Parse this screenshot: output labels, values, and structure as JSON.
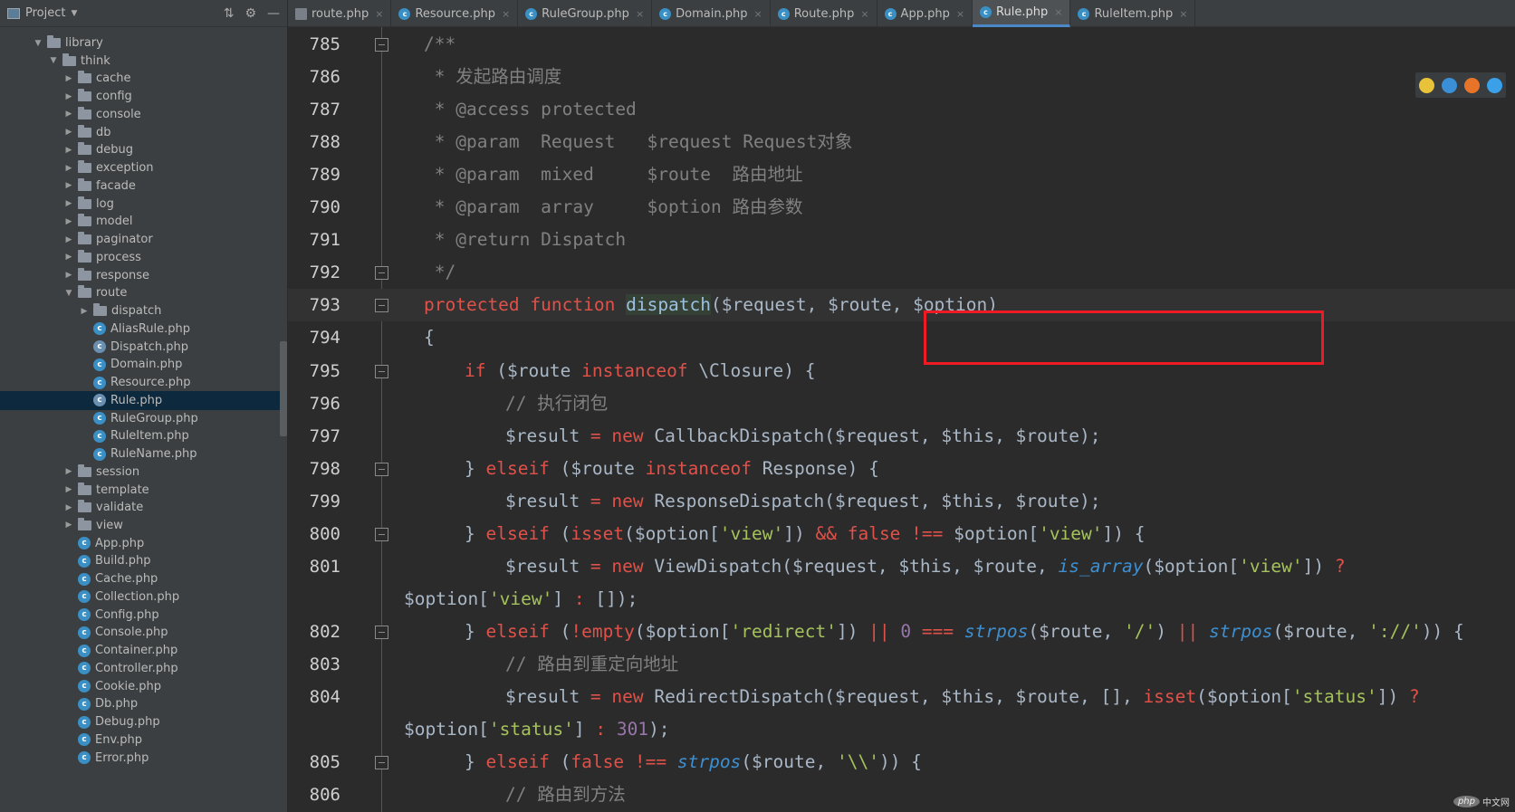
{
  "project_panel": {
    "title": "Project",
    "tree": [
      {
        "label": "library",
        "type": "folder",
        "depth": 0,
        "state": "expanded"
      },
      {
        "label": "think",
        "type": "folder",
        "depth": 1,
        "state": "expanded"
      },
      {
        "label": "cache",
        "type": "folder",
        "depth": 2,
        "state": "collapsed"
      },
      {
        "label": "config",
        "type": "folder",
        "depth": 2,
        "state": "collapsed"
      },
      {
        "label": "console",
        "type": "folder",
        "depth": 2,
        "state": "collapsed"
      },
      {
        "label": "db",
        "type": "folder",
        "depth": 2,
        "state": "collapsed"
      },
      {
        "label": "debug",
        "type": "folder",
        "depth": 2,
        "state": "collapsed"
      },
      {
        "label": "exception",
        "type": "folder",
        "depth": 2,
        "state": "collapsed"
      },
      {
        "label": "facade",
        "type": "folder",
        "depth": 2,
        "state": "collapsed"
      },
      {
        "label": "log",
        "type": "folder",
        "depth": 2,
        "state": "collapsed"
      },
      {
        "label": "model",
        "type": "folder",
        "depth": 2,
        "state": "collapsed"
      },
      {
        "label": "paginator",
        "type": "folder",
        "depth": 2,
        "state": "collapsed"
      },
      {
        "label": "process",
        "type": "folder",
        "depth": 2,
        "state": "collapsed"
      },
      {
        "label": "response",
        "type": "folder",
        "depth": 2,
        "state": "collapsed"
      },
      {
        "label": "route",
        "type": "folder",
        "depth": 2,
        "state": "expanded"
      },
      {
        "label": "dispatch",
        "type": "folder",
        "depth": 3,
        "state": "collapsed"
      },
      {
        "label": "AliasRule.php",
        "type": "class",
        "depth": 3
      },
      {
        "label": "Dispatch.php",
        "type": "abstract",
        "depth": 3
      },
      {
        "label": "Domain.php",
        "type": "class",
        "depth": 3
      },
      {
        "label": "Resource.php",
        "type": "class",
        "depth": 3
      },
      {
        "label": "Rule.php",
        "type": "abstract",
        "depth": 3,
        "selected": true
      },
      {
        "label": "RuleGroup.php",
        "type": "class",
        "depth": 3
      },
      {
        "label": "RuleItem.php",
        "type": "class",
        "depth": 3
      },
      {
        "label": "RuleName.php",
        "type": "class",
        "depth": 3
      },
      {
        "label": "session",
        "type": "folder",
        "depth": 2,
        "state": "collapsed"
      },
      {
        "label": "template",
        "type": "folder",
        "depth": 2,
        "state": "collapsed"
      },
      {
        "label": "validate",
        "type": "folder",
        "depth": 2,
        "state": "collapsed"
      },
      {
        "label": "view",
        "type": "folder",
        "depth": 2,
        "state": "collapsed"
      },
      {
        "label": "App.php",
        "type": "class",
        "depth": 2
      },
      {
        "label": "Build.php",
        "type": "class",
        "depth": 2
      },
      {
        "label": "Cache.php",
        "type": "class",
        "depth": 2
      },
      {
        "label": "Collection.php",
        "type": "class",
        "depth": 2
      },
      {
        "label": "Config.php",
        "type": "class",
        "depth": 2
      },
      {
        "label": "Console.php",
        "type": "class",
        "depth": 2
      },
      {
        "label": "Container.php",
        "type": "class",
        "depth": 2
      },
      {
        "label": "Controller.php",
        "type": "class",
        "depth": 2
      },
      {
        "label": "Cookie.php",
        "type": "class",
        "depth": 2
      },
      {
        "label": "Db.php",
        "type": "class",
        "depth": 2
      },
      {
        "label": "Debug.php",
        "type": "class",
        "depth": 2
      },
      {
        "label": "Env.php",
        "type": "class",
        "depth": 2
      },
      {
        "label": "Error.php",
        "type": "class",
        "depth": 2
      }
    ]
  },
  "tabs": [
    {
      "label": "route.php",
      "icon": "php-file-icon",
      "active": false
    },
    {
      "label": "Resource.php",
      "icon": "class-icon",
      "active": false
    },
    {
      "label": "RuleGroup.php",
      "icon": "class-icon",
      "active": false
    },
    {
      "label": "Domain.php",
      "icon": "class-icon",
      "active": false
    },
    {
      "label": "Route.php",
      "icon": "class-icon",
      "active": false
    },
    {
      "label": "App.php",
      "icon": "class-icon",
      "active": false
    },
    {
      "label": "Rule.php",
      "icon": "abstract-class-icon",
      "active": true
    },
    {
      "label": "RuleItem.php",
      "icon": "class-icon",
      "active": false
    }
  ],
  "editor": {
    "current_line": "793",
    "lines": [
      {
        "num": "785",
        "fold": true,
        "html": "<span class='c'>/**</span>",
        "indent": 1
      },
      {
        "num": "786",
        "html": "<span class='c'> * 发起路由调度</span>",
        "indent": 1
      },
      {
        "num": "787",
        "html": "<span class='c'> * @access protected</span>",
        "indent": 1
      },
      {
        "num": "788",
        "html": "<span class='c'> * @param  Request   $request Request对象</span>",
        "indent": 1
      },
      {
        "num": "789",
        "html": "<span class='c'> * @param  mixed     $route  路由地址</span>",
        "indent": 1
      },
      {
        "num": "790",
        "html": "<span class='c'> * @param  array     $option 路由参数</span>",
        "indent": 1
      },
      {
        "num": "791",
        "html": "<span class='c'> * @return Dispatch</span>",
        "indent": 1
      },
      {
        "num": "792",
        "fold": true,
        "html": "<span class='c'> */</span>",
        "indent": 1
      },
      {
        "num": "793",
        "fold": true,
        "html": "<span class='kr'>protected</span> <span class='kr'>function</span> <span class='hl-fn'>dispatch</span><span class='tx'>($request, $route, $option)</span>",
        "indent": 1
      },
      {
        "num": "794",
        "html": "<span class='tx'>{</span>",
        "indent": 1
      },
      {
        "num": "795",
        "fold": true,
        "html": "<span class='kr'>if</span> <span class='tx'>($route </span><span class='kr'>instanceof</span><span class='tx'> \\Closure) {</span>",
        "indent": 2
      },
      {
        "num": "796",
        "html": "<span class='c'>// 执行闭包</span>",
        "indent": 3
      },
      {
        "num": "797",
        "html": "<span class='tx'>$result </span><span class='op'>=</span> <span class='kr'>new</span><span class='tx'> CallbackDispatch($request, $this, $route);</span>",
        "indent": 3
      },
      {
        "num": "798",
        "fold": true,
        "html": "<span class='tx'>} </span><span class='kr'>elseif</span><span class='tx'> ($route </span><span class='kr'>instanceof</span><span class='tx'> Response) {</span>",
        "indent": 2
      },
      {
        "num": "799",
        "html": "<span class='tx'>$result </span><span class='op'>=</span> <span class='kr'>new</span><span class='tx'> ResponseDispatch($request, $this, $route);</span>",
        "indent": 3
      },
      {
        "num": "800",
        "fold": true,
        "html": "<span class='tx'>} </span><span class='kr'>elseif</span><span class='tx'> (</span><span class='kr'>isset</span><span class='tx'>($option[</span><span class='s'>'view'</span><span class='tx'>]) </span><span class='op'>&amp;&amp;</span> <span class='kr'>false</span> <span class='op'>!==</span><span class='tx'> $option[</span><span class='s'>'view'</span><span class='tx'>]) {</span>",
        "indent": 2
      },
      {
        "num": "801",
        "html": "<span class='tx'>$result </span><span class='op'>=</span> <span class='kr'>new</span><span class='tx'> ViewDispatch($request, $this, $route, </span><span class='it'>is_array</span><span class='tx'>($option[</span><span class='s'>'view'</span><span class='tx'>]) </span><span class='op'>?</span>",
        "indent": 3
      },
      {
        "num": "",
        "wrap": true,
        "html": "<span class='tx'>$option[</span><span class='s'>'view'</span><span class='tx'>] </span><span class='op'>:</span><span class='tx'> []);</span>",
        "indent": 0
      },
      {
        "num": "802",
        "fold": true,
        "html": "<span class='tx'>} </span><span class='kr'>elseif</span><span class='tx'> (</span><span class='op'>!</span><span class='kr'>empty</span><span class='tx'>($option[</span><span class='s'>'redirect'</span><span class='tx'>]) </span><span class='op'>||</span> <span class='n'>0</span> <span class='op'>===</span> <span class='it'>strpos</span><span class='tx'>($route, </span><span class='s'>'/'</span><span class='tx'>) </span><span class='op'>||</span> <span class='it'>strpos</span><span class='tx'>($route, </span><span class='s'>'://'</span><span class='tx'>)) {</span>",
        "indent": 2
      },
      {
        "num": "803",
        "html": "<span class='c'>// 路由到重定向地址</span>",
        "indent": 3
      },
      {
        "num": "804",
        "html": "<span class='tx'>$result </span><span class='op'>=</span> <span class='kr'>new</span><span class='tx'> RedirectDispatch($request, $this, $route, [], </span><span class='kr'>isset</span><span class='tx'>($option[</span><span class='s'>'status'</span><span class='tx'>]) </span><span class='op'>?</span>",
        "indent": 3
      },
      {
        "num": "",
        "wrap": true,
        "html": "<span class='tx'>$option[</span><span class='s'>'status'</span><span class='tx'>] </span><span class='op'>:</span> <span class='n'>301</span><span class='tx'>);</span>",
        "indent": 0
      },
      {
        "num": "805",
        "fold": true,
        "html": "<span class='tx'>} </span><span class='kr'>elseif</span><span class='tx'> (</span><span class='kr'>false</span> <span class='op'>!==</span> <span class='it'>strpos</span><span class='tx'>($route, </span><span class='s'>'\\\\'</span><span class='tx'>)) {</span>",
        "indent": 2
      },
      {
        "num": "806",
        "html": "<span class='c'>// 路由到方法</span>",
        "indent": 3
      }
    ]
  },
  "browser_icons": [
    {
      "name": "chrome-icon",
      "color": "#e8c33a"
    },
    {
      "name": "edge-icon",
      "color": "#3a8fd6"
    },
    {
      "name": "firefox-icon",
      "color": "#e8742a"
    },
    {
      "name": "safari-icon",
      "color": "#3aa0e8"
    }
  ],
  "watermark": {
    "logo": "php",
    "text": "中文网"
  }
}
